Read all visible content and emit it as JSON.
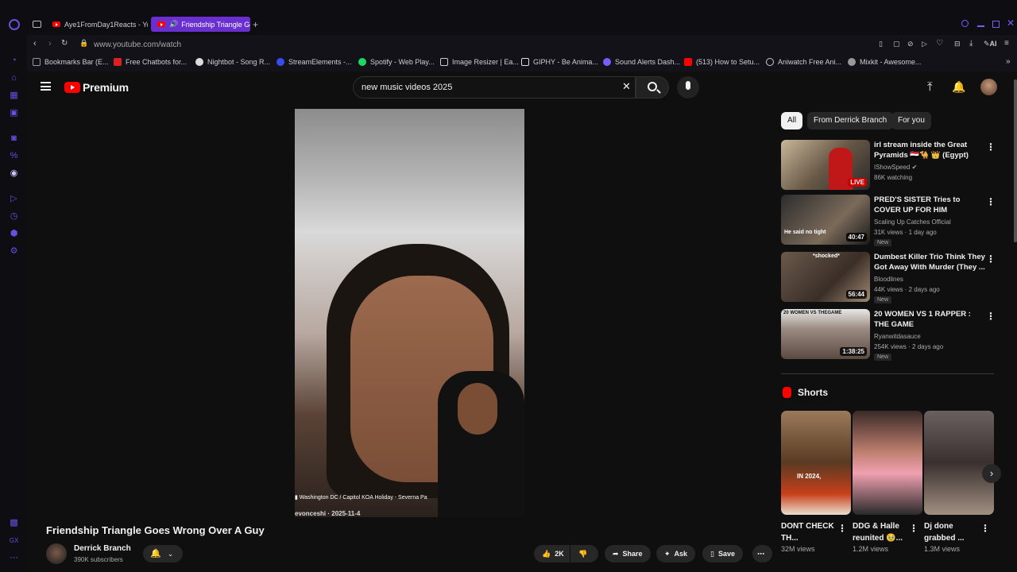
{
  "browser": {
    "tabs": [
      {
        "label": "Aye1FromDay1Reacts - Yo"
      },
      {
        "label": "Friendship Triangle Go"
      }
    ],
    "url": "www.youtube.com/watch",
    "ai_label": "AI",
    "bookmarks": [
      {
        "label": "Bookmarks Bar (E...",
        "color": "#888888"
      },
      {
        "label": "Free Chatbots for...",
        "color": "#e02020"
      },
      {
        "label": "Nightbot - Song R...",
        "color": "#dddddd"
      },
      {
        "label": "StreamElements -...",
        "color": "#3a4cf0"
      },
      {
        "label": "Spotify - Web Play...",
        "color": "#1ed760"
      },
      {
        "label": "Image Resizer | Ea...",
        "color": "#cccccc"
      },
      {
        "label": "GIPHY - Be Anima...",
        "color": "#dddddd"
      },
      {
        "label": "Sound Alerts Dash...",
        "color": "#7b5cff"
      },
      {
        "label": "(513) How to Setu...",
        "color": "#ff0000"
      },
      {
        "label": "Aniwatch Free Ani...",
        "color": "#cccccc"
      },
      {
        "label": "Mixkit - Awesome...",
        "color": "#999999"
      }
    ]
  },
  "youtube": {
    "logo_label": "Premium",
    "search_value": "new music videos 2025",
    "video": {
      "title": "Friendship Triangle Goes Wrong Over A Guy",
      "channel": "Derrick Branch",
      "subscribers": "390K subscribers",
      "overlay_location": "Washington DC / Capitol KOA Holiday - Severna Pa",
      "overlay_handle": "evonceshi · 2025-11-4"
    },
    "actions": {
      "likes": "2K",
      "share": "Share",
      "ask": "Ask",
      "save": "Save"
    },
    "chips": [
      "All",
      "From Derrick Branch",
      "For you"
    ],
    "recommendations": [
      {
        "title": "irl stream inside the Great Pyramids 🇪🇬🐪 👑 (Egypt)",
        "channel": "IShowSpeed",
        "meta": "86K watching",
        "badge": "LIVE",
        "new": ""
      },
      {
        "title": "PRED'S SISTER Tries to COVER UP FOR HIM",
        "channel": "Scaling Up Catches Official",
        "meta": "31K views · 1 day ago",
        "badge": "40:47",
        "new": "New"
      },
      {
        "title": "Dumbest Killer Trio Think They Got Away With Murder (They ...",
        "channel": "Bloodlines",
        "meta": "44K views · 2 days ago",
        "badge": "56:44",
        "new": "New"
      },
      {
        "title": "20 WOMEN VS 1 RAPPER : THE GAME",
        "channel": "Ryanwitdasauce",
        "meta": "254K views · 2 days ago",
        "badge": "1:38:25",
        "new": "New"
      }
    ],
    "thumb_texts": {
      "t2": "He said no tight",
      "t3": "*shocked*",
      "t4": "20 WOMEN VS THEGAME"
    },
    "shorts_heading": "Shorts",
    "shorts": [
      {
        "title": "DONT CHECK TH...",
        "views": "32M views",
        "overlay": "IN 2024,"
      },
      {
        "title": "DDG & Halle reunited 🥹...",
        "views": "1.2M views",
        "overlay": ""
      },
      {
        "title": "Dj done grabbed ...",
        "views": "1.3M views",
        "overlay": ""
      }
    ]
  },
  "colors": {
    "accent": "#6a2fd0",
    "youtube_red": "#ff0000"
  }
}
